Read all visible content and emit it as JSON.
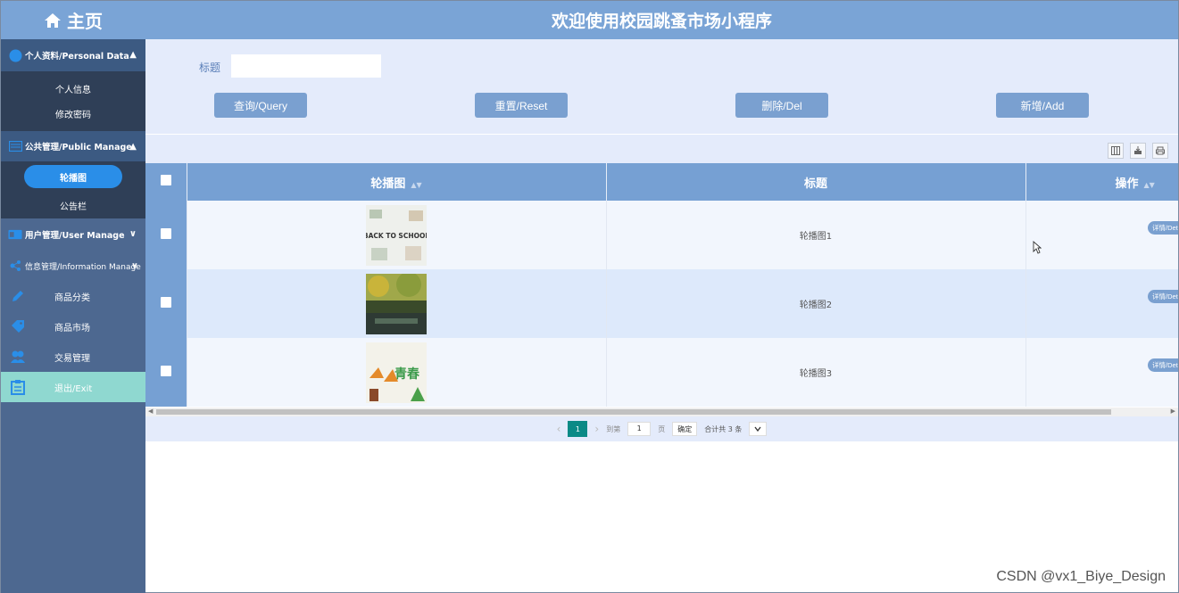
{
  "sidebar": {
    "home_label": "主页",
    "groups": [
      {
        "label": "个人资料/Personal Data",
        "chevron": "▲",
        "items": [
          {
            "label": "个人信息"
          },
          {
            "label": "修改密码"
          }
        ]
      },
      {
        "label": "公共管理/Public Manage",
        "chevron": "▲",
        "items": [
          {
            "label": "轮播图",
            "active": true
          },
          {
            "label": "公告栏"
          }
        ]
      },
      {
        "label": "用户管理/User Manage",
        "chevron": "∨"
      },
      {
        "label": "信息管理/Information Manage",
        "chevron": "∨"
      }
    ],
    "nav": [
      {
        "label": "商品分类",
        "icon": "pencil-icon"
      },
      {
        "label": "商品市场",
        "icon": "tag-icon"
      },
      {
        "label": "交易管理",
        "icon": "users-icon"
      },
      {
        "label": "退出/Exit",
        "icon": "clipboard-icon"
      }
    ]
  },
  "header": {
    "title": "欢迎使用校园跳蚤市场小程序"
  },
  "search": {
    "label": "标题",
    "value": "",
    "placeholder": ""
  },
  "buttons": {
    "query": "查询/Query",
    "reset": "重置/Reset",
    "delete": "删除/Del",
    "add": "新增/Add"
  },
  "table": {
    "columns": [
      "轮播图",
      "标题",
      "操作"
    ],
    "rows": [
      {
        "image": "back to school banner",
        "image_text": "BACK TO SCHOOL",
        "title": "轮播图1",
        "action": "详情/Details"
      },
      {
        "image": "campus autumn scene",
        "image_text": "",
        "title": "轮播图2",
        "action": "详情/Details"
      },
      {
        "image": "youth green poster",
        "image_text": "青春",
        "title": "轮播图3",
        "action": "详情/Details"
      }
    ]
  },
  "pager": {
    "prev": "‹",
    "current": "1",
    "next": "›",
    "goto_label": "到第",
    "goto_value": "1",
    "page_unit": "页",
    "confirm": "确定",
    "total": "合计共 3 条"
  },
  "watermark": "CSDN @vx1_Biye_Design",
  "colors": {
    "sidebar": "#4d6890",
    "header": "#7aa4d6",
    "panel": "#e4ebfb",
    "accent": "#2a8ee8",
    "exit": "#8fd8d0",
    "pager_active": "#0b8a86"
  }
}
